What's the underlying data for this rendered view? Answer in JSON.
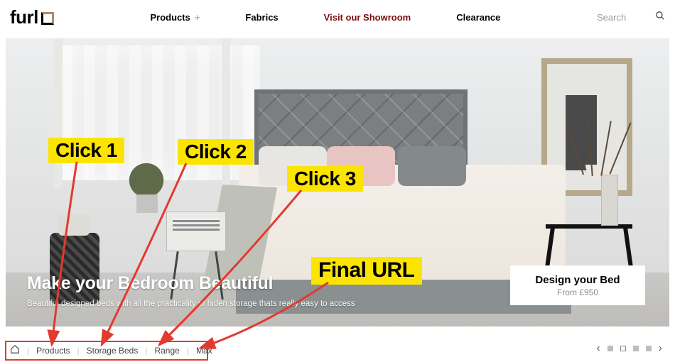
{
  "brand": {
    "name": "furl"
  },
  "nav": {
    "products": "Products",
    "fabrics": "Fabrics",
    "showroom": "Visit our Showroom",
    "clearance": "Clearance"
  },
  "search": {
    "placeholder": "Search"
  },
  "hero": {
    "title": "Make your Bedroom Beautiful",
    "subtitle": "Beautiful designed beds with all the practicality of hiden storage thats really easy to access"
  },
  "cta": {
    "title": "Design your Bed",
    "sub": "From £950"
  },
  "breadcrumb": {
    "items": [
      "Products",
      "Storage Beds",
      "Range",
      "Max"
    ]
  },
  "annotations": {
    "click1": "Click 1",
    "click2": "Click 2",
    "click3": "Click 3",
    "final": "Final URL"
  },
  "colors": {
    "accent_nav": "#7b0f12",
    "annotation_bg": "#fbe400",
    "arrow": "#e23a2e"
  }
}
